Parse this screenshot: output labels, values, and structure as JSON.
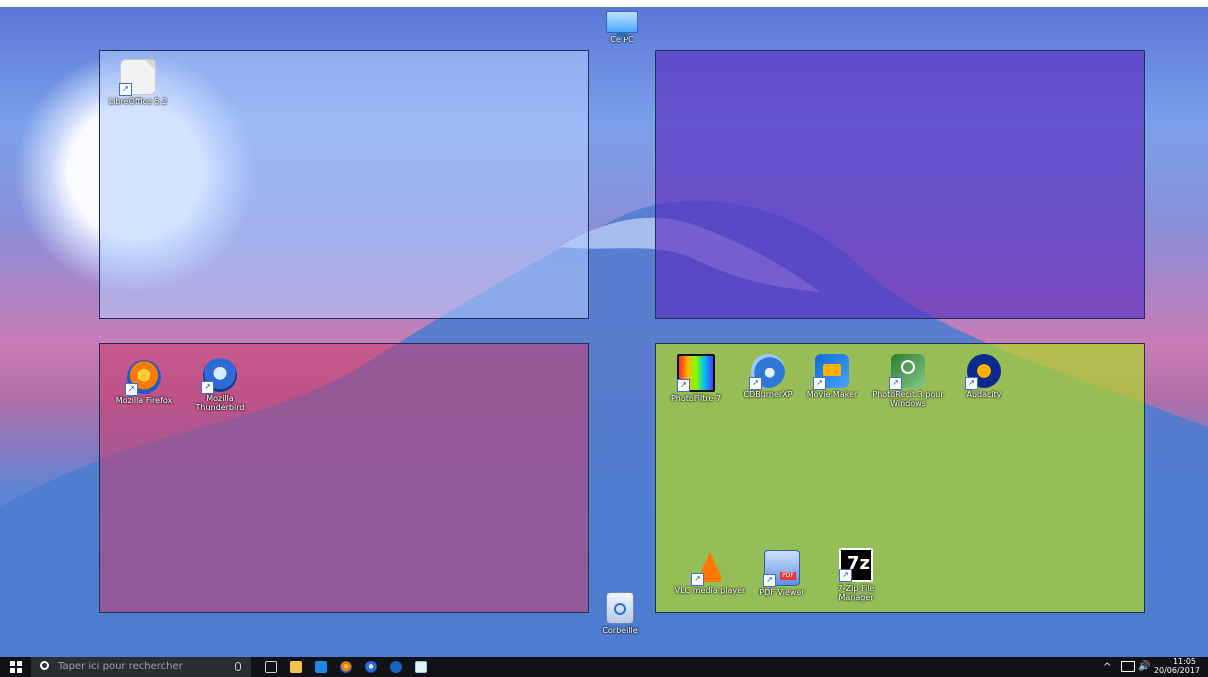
{
  "desktop": {
    "top_icons": [
      {
        "name": "Ce PC",
        "icon": "computer-icon"
      }
    ],
    "bottom_icons": [
      {
        "name": "Corbeille",
        "icon": "recycle-bin-icon"
      }
    ],
    "zones": {
      "tl": {
        "icons": [
          {
            "name": "LibreOffice 5.2",
            "icon": "document-icon"
          }
        ]
      },
      "tr": {
        "icons": []
      },
      "bl": {
        "icons": [
          {
            "name": "Mozilla Firefox",
            "icon": "firefox-icon"
          },
          {
            "name": "Mozilla Thunderbird",
            "icon": "thunderbird-icon"
          }
        ]
      },
      "br": {
        "icons": [
          {
            "name": "PhotoFiltre 7",
            "icon": "photofiltre-icon"
          },
          {
            "name": "CDBurnerXP",
            "icon": "cdburner-icon"
          },
          {
            "name": "Movie Maker",
            "icon": "movie-maker-icon"
          },
          {
            "name": "PhotoRecit 3 pour Windows",
            "icon": "photorecit-icon"
          },
          {
            "name": "Audacity",
            "icon": "audacity-icon"
          },
          {
            "name": "VLC media player",
            "icon": "vlc-icon"
          },
          {
            "name": "PDF Viewer",
            "icon": "pdf-icon"
          },
          {
            "name": "7-Zip File Manager",
            "icon": "7zip-icon"
          }
        ]
      }
    }
  },
  "taskbar": {
    "search_placeholder": "Taper ici pour rechercher",
    "buttons": [
      "task-view-icon",
      "file-explorer-icon",
      "store-icon",
      "firefox-icon",
      "thunderbird-icon",
      "teamviewer-icon",
      "document-icon"
    ],
    "tray": {
      "time": "11:05",
      "date": "20/06/2017"
    }
  },
  "colors": {
    "zone_tl": "#b4cdff",
    "zone_tr": "#5a2dbe",
    "zone_bl": "#c83c6e",
    "zone_br": "#afd728"
  }
}
